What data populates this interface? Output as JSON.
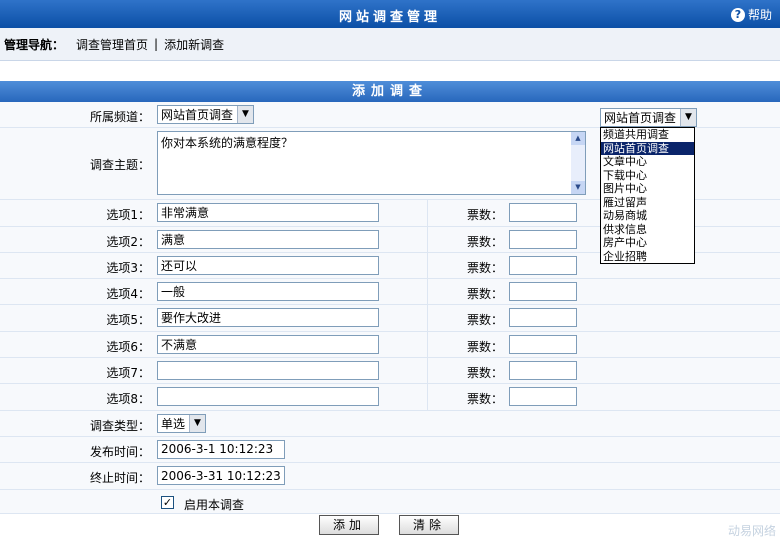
{
  "header": {
    "title": "网站调查管理",
    "help_label": "帮助"
  },
  "nav": {
    "label": "管理导航：",
    "links": [
      "调查管理首页",
      "添加新调查"
    ],
    "separator": "|"
  },
  "section": {
    "title": "添加调查"
  },
  "form": {
    "channel": {
      "label": "所属频道：",
      "value": "网站首页调查"
    },
    "topic": {
      "label": "调查主题：",
      "value": "你对本系统的满意程度？"
    },
    "options": [
      {
        "label": "选项1：",
        "value": "非常满意",
        "vote_label": "票数：",
        "votes": ""
      },
      {
        "label": "选项2：",
        "value": "满意",
        "vote_label": "票数：",
        "votes": ""
      },
      {
        "label": "选项3：",
        "value": "还可以",
        "vote_label": "票数：",
        "votes": ""
      },
      {
        "label": "选项4：",
        "value": "一般",
        "vote_label": "票数：",
        "votes": ""
      },
      {
        "label": "选项5：",
        "value": "要作大改进",
        "vote_label": "票数：",
        "votes": ""
      },
      {
        "label": "选项6：",
        "value": "不满意",
        "vote_label": "票数：",
        "votes": ""
      },
      {
        "label": "选项7：",
        "value": "",
        "vote_label": "票数：",
        "votes": ""
      },
      {
        "label": "选项8：",
        "value": "",
        "vote_label": "票数：",
        "votes": ""
      }
    ],
    "type": {
      "label": "调查类型：",
      "value": "单选"
    },
    "publish_time": {
      "label": "发布时间：",
      "value": "2006-3-1 10:12:23"
    },
    "end_time": {
      "label": "终止时间：",
      "value": "2006-3-31 10:12:23"
    },
    "enable": {
      "label": "启用本调查",
      "checked": true
    }
  },
  "buttons": {
    "add": "添加",
    "clear": "清除"
  },
  "watermark": "动易网络",
  "dropdown": {
    "selected": "网站首页调查",
    "options": [
      "频道共用调查",
      "网站首页调查",
      "文章中心",
      "下载中心",
      "图片中心",
      "雁过留声",
      "动易商城",
      "供求信息",
      "房产中心",
      "企业招聘"
    ],
    "highlighted_index": 1
  }
}
